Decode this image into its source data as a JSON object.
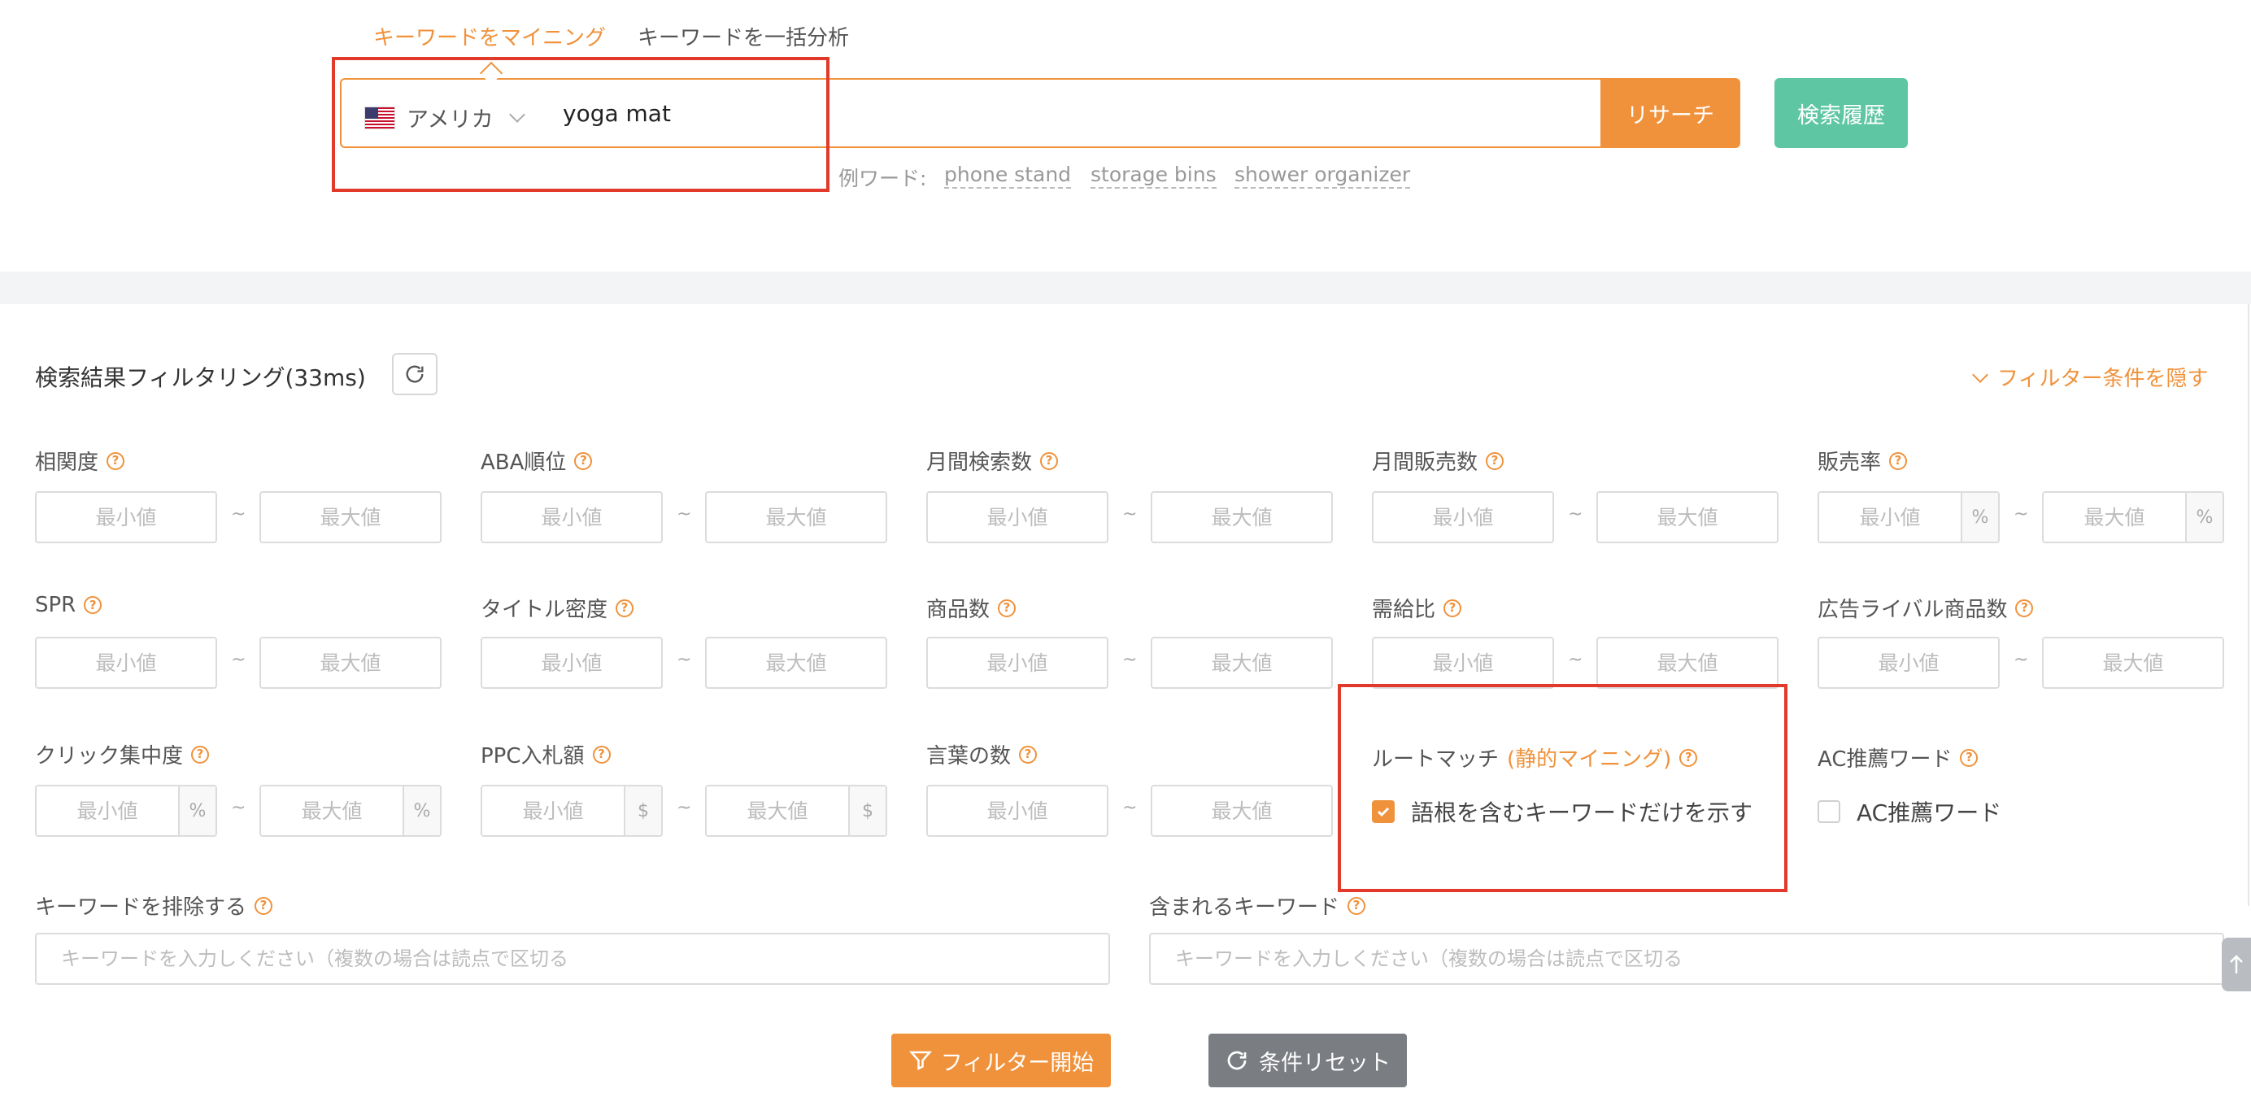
{
  "tabs": [
    {
      "label": "キーワードをマイニング",
      "active": true
    },
    {
      "label": "キーワードを一括分析",
      "active": false
    }
  ],
  "search": {
    "country": "アメリカ",
    "query": "yoga mat",
    "research_label": "リサーチ",
    "history_label": "検索履歴",
    "example_label": "例ワード:",
    "examples": [
      "phone stand",
      "storage bins",
      "shower organizer"
    ]
  },
  "filter": {
    "title": "検索結果フィルタリング(33ms)",
    "hide_label": "フィルター条件を隠す",
    "min_placeholder": "最小値",
    "max_placeholder": "最大値",
    "tilde": "~",
    "units": {
      "percent": "%",
      "dollar": "$"
    },
    "fields": {
      "relevance": "相関度",
      "aba_rank": "ABA順位",
      "monthly_search": "月間検索数",
      "monthly_sales": "月間販売数",
      "sales_rate": "販売率",
      "spr": "SPR",
      "title_density": "タイトル密度",
      "product_count": "商品数",
      "supply_demand": "需給比",
      "ad_competitors": "広告ライバル商品数",
      "click_concentration": "クリック集中度",
      "ppc_bid": "PPC入札額",
      "word_count": "言葉の数"
    },
    "root_match": {
      "label": "ルートマッチ",
      "label_accent": "(静的マイニング)",
      "checkbox_label": "語根を含むキーワードだけを示す",
      "checked": true
    },
    "ac": {
      "label": "AC推薦ワード",
      "checkbox_label": "AC推薦ワード",
      "checked": false
    },
    "exclude": {
      "label": "キーワードを排除する",
      "placeholder": "キーワードを入力しください（複数の場合は読点で区切る"
    },
    "include": {
      "label": "含まれるキーワード",
      "placeholder": "キーワードを入力しください（複数の場合は読点で区切る"
    },
    "start_label": "フィルター開始",
    "reset_label": "条件リセット"
  },
  "colors": {
    "accent": "#f0923b",
    "history": "#5fc6a4",
    "reset": "#7a7d82",
    "annotation": "#e23a2a"
  }
}
